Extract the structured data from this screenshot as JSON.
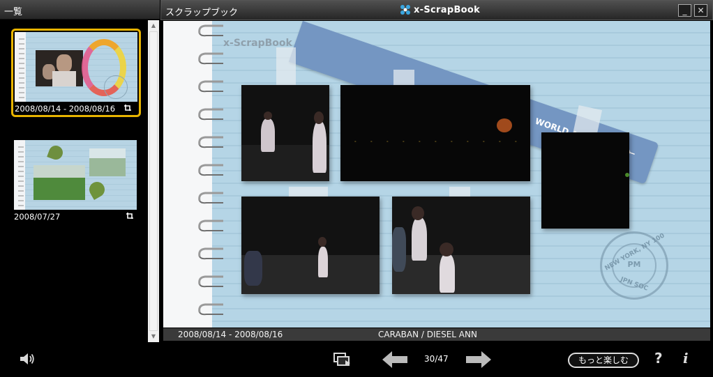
{
  "left_panel": {
    "header": "一覧",
    "items": [
      {
        "date": "2008/08/14 - 2008/08/16",
        "selected": true
      },
      {
        "date": "2008/07/27",
        "selected": false
      }
    ]
  },
  "window": {
    "title": "スクラップブック",
    "app_name": "x-ScrapBook",
    "minimize": "_",
    "close": "✕"
  },
  "page": {
    "brand": "x-ScrapBook",
    "tag_text": "WORLD AIR LINES",
    "stamp": {
      "top": "NEW YORK, NY 100",
      "center": "PM",
      "bottom": "JPN SOC"
    }
  },
  "caption": {
    "date": "2008/08/14 - 2008/08/16",
    "title": "CARABAN / DIESEL ANN"
  },
  "controls": {
    "counter": "30/47",
    "more_fun": "もっと楽しむ",
    "help": "?",
    "info": "i"
  },
  "colors": {
    "accent_selected": "#e8b400",
    "page_blue": "#b5d5e6",
    "tag_blue": "#7496c2"
  }
}
